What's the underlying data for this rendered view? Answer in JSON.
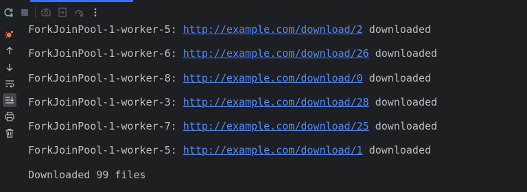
{
  "toolbar": {
    "rerun_icon": "rerun-icon",
    "stop_icon": "stop-icon",
    "screenshot_icon": "camera-icon",
    "restore_layout_icon": "exit-icon",
    "profiler_icon": "gauge-icon",
    "more_icon": "more-vert-icon"
  },
  "gutter": {
    "items": [
      "debug-icon",
      "arrow-up-icon",
      "arrow-down-icon",
      "soft-wrap-icon",
      "scroll-to-end-icon",
      "print-icon",
      "trash-icon"
    ]
  },
  "console": {
    "lines": [
      {
        "prefix": "ForkJoinPool-1-worker-5: ",
        "url": "http://example.com/download/2",
        "suffix": " downloaded"
      },
      {
        "prefix": "ForkJoinPool-1-worker-6: ",
        "url": "http://example.com/download/26",
        "suffix": " downloaded"
      },
      {
        "prefix": "ForkJoinPool-1-worker-8: ",
        "url": "http://example.com/download/0",
        "suffix": " downloaded"
      },
      {
        "prefix": "ForkJoinPool-1-worker-3: ",
        "url": "http://example.com/download/28",
        "suffix": " downloaded"
      },
      {
        "prefix": "ForkJoinPool-1-worker-7: ",
        "url": "http://example.com/download/25",
        "suffix": " downloaded"
      },
      {
        "prefix": "ForkJoinPool-1-worker-5: ",
        "url": "http://example.com/download/1",
        "suffix": " downloaded"
      }
    ],
    "summary": "Downloaded 99 files"
  },
  "colors": {
    "background": "#1e1f22",
    "text": "#bcbec4",
    "link": "#548af7",
    "accent": "#3574f0",
    "debug_icon": "#e8743b"
  }
}
